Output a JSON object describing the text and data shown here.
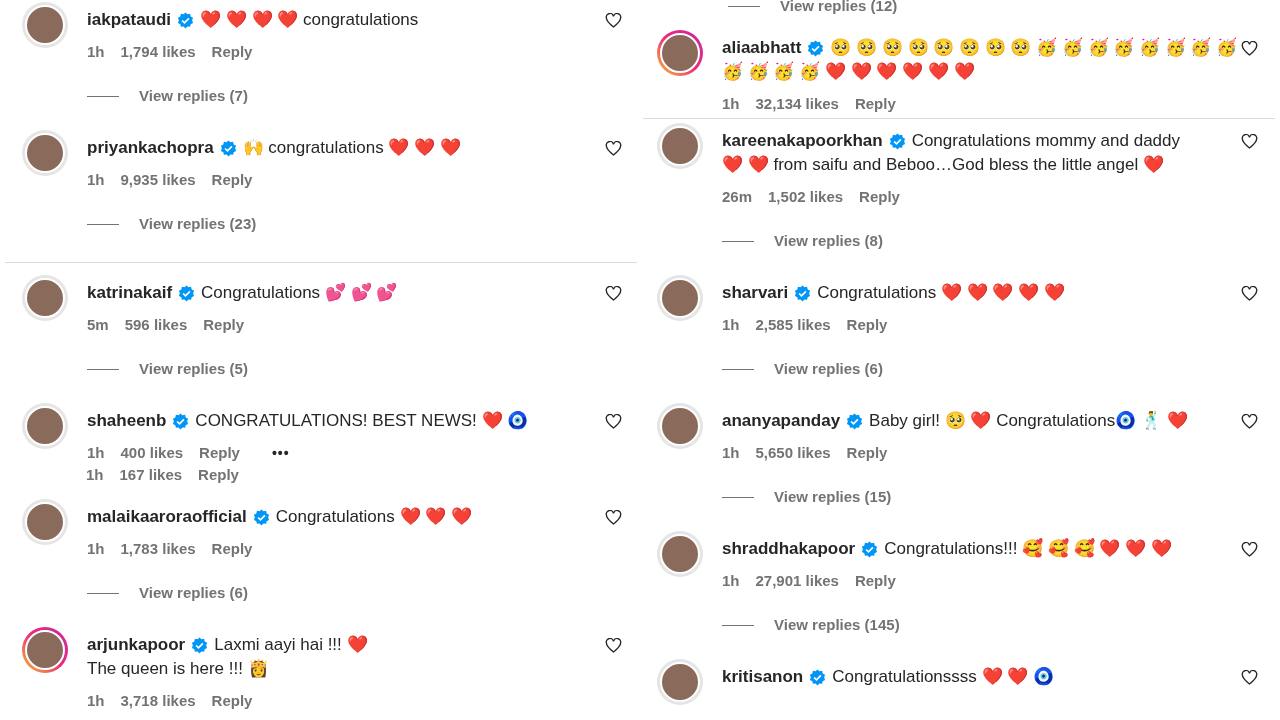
{
  "columns": [
    {
      "items": [
        {
          "kind": "comment",
          "user": "iakpataudi",
          "ring": false,
          "lines": [
            "❤️ ❤️ ❤️ ❤️ congratulations"
          ],
          "time": "1h",
          "likes": "1,794 likes",
          "reply": "Reply",
          "replies": "View replies (7)"
        },
        {
          "kind": "comment",
          "user": "priyankachopra",
          "ring": false,
          "lines": [
            "🙌 congratulations ❤️ ❤️ ❤️"
          ],
          "time": "1h",
          "likes": "9,935 likes",
          "reply": "Reply",
          "replies": "View replies (23)"
        },
        {
          "kind": "divider"
        },
        {
          "kind": "comment",
          "user": "katrinakaif",
          "ring": false,
          "lines": [
            "Congratulations 💕 💕 💕"
          ],
          "time": "5m",
          "likes": "596 likes",
          "reply": "Reply",
          "replies": "View replies (5)"
        },
        {
          "kind": "comment",
          "user": "shaheenb",
          "ring": false,
          "lines": [
            "CONGRATULATIONS! BEST NEWS! ❤️ 🧿"
          ],
          "time": "1h",
          "likes": "400 likes",
          "reply": "Reply",
          "more": "•••"
        },
        {
          "kind": "meta_stub",
          "time": "1h",
          "likes": "167 likes",
          "reply": "Reply"
        },
        {
          "kind": "comment",
          "user": "malaikaaroraofficial",
          "ring": false,
          "lines": [
            "Congratulations ❤️ ❤️ ❤️"
          ],
          "time": "1h",
          "likes": "1,783 likes",
          "reply": "Reply",
          "replies": "View replies (6)"
        },
        {
          "kind": "comment",
          "user": "arjunkapoor",
          "ring": true,
          "lines": [
            "Laxmi aayi hai !!! ❤️",
            "The queen is here !!! 👸"
          ],
          "time": "1h",
          "likes": "3,718 likes",
          "reply": "Reply"
        }
      ]
    },
    {
      "items": [
        {
          "kind": "replies_stub",
          "replies": "View replies (12)"
        },
        {
          "kind": "comment",
          "user": "aliaabhatt",
          "ring": true,
          "lines": [
            "🥺 🥺 🥺 🥺 🥺 🥺 🥺 🥺 🥳 🥳 🥳 🥳 🥳 🥳 🥳 🥳",
            "🥳 🥳 🥳 🥳 ❤️ ❤️ ❤️ ❤️ ❤️ ❤️"
          ],
          "time": "1h",
          "likes": "32,134 likes",
          "reply": "Reply"
        },
        {
          "kind": "divider"
        },
        {
          "kind": "comment",
          "user": "kareenakapoorkhan",
          "ring": false,
          "lines": [
            "Congratulations mommy and daddy",
            "❤️ ❤️ from saifu and Beboo…God bless the little angel ❤️"
          ],
          "time": "26m",
          "likes": "1,502 likes",
          "reply": "Reply",
          "replies": "View replies (8)"
        },
        {
          "kind": "comment",
          "user": "sharvari",
          "ring": false,
          "lines": [
            "Congratulations ❤️ ❤️ ❤️ ❤️ ❤️"
          ],
          "time": "1h",
          "likes": "2,585 likes",
          "reply": "Reply",
          "replies": "View replies (6)"
        },
        {
          "kind": "comment",
          "user": "ananyapanday",
          "ring": false,
          "lines": [
            "Baby girl! 🥺 ❤️ Congratulations🧿 🕺 ❤️"
          ],
          "time": "1h",
          "likes": "5,650 likes",
          "reply": "Reply",
          "replies": "View replies (15)"
        },
        {
          "kind": "comment",
          "user": "shraddhakapoor",
          "ring": false,
          "lines": [
            "Congratulations!!! 🥰 🥰 🥰 ❤️ ❤️ ❤️"
          ],
          "time": "1h",
          "likes": "27,901 likes",
          "reply": "Reply",
          "replies": "View replies (145)"
        },
        {
          "kind": "comment",
          "user": "kritisanon",
          "ring": false,
          "lines": [
            "Congratulationssss ❤️ ❤️ 🧿"
          ]
        }
      ]
    }
  ]
}
